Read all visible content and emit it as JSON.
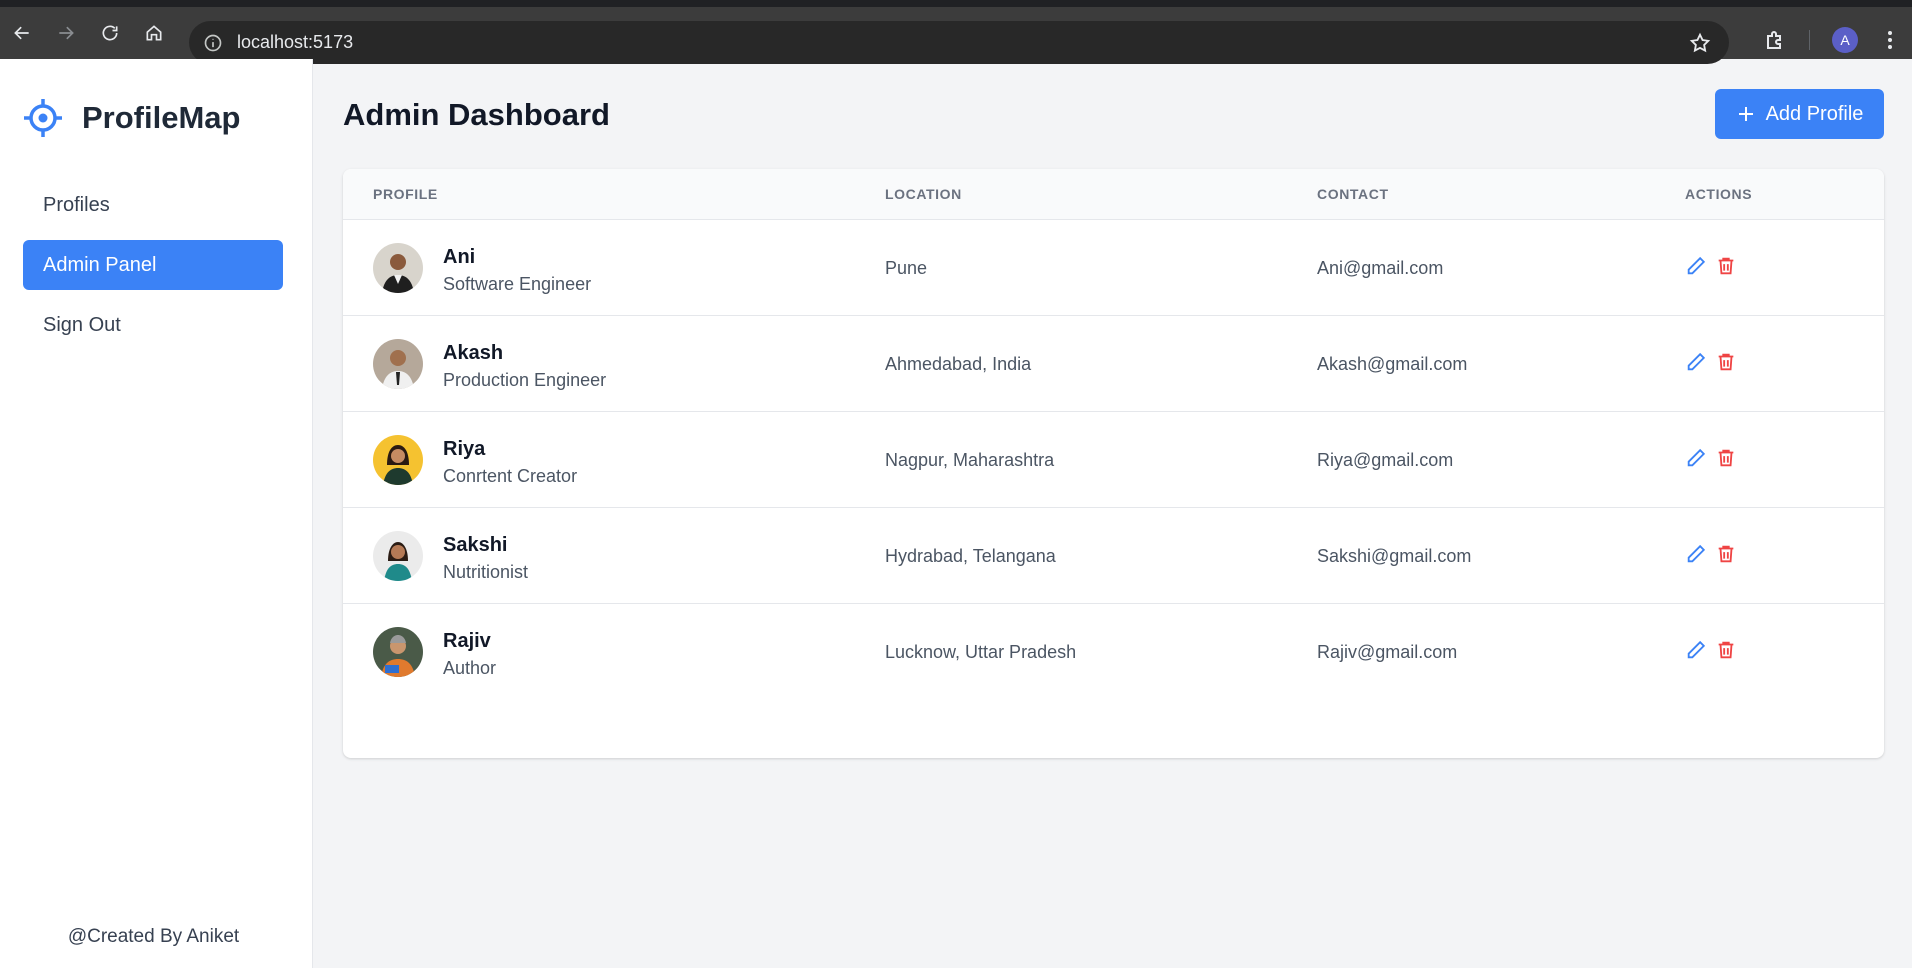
{
  "browser": {
    "url": "localhost:5173",
    "profile_initial": "A"
  },
  "sidebar": {
    "brand": "ProfileMap",
    "items": [
      {
        "label": "Profiles",
        "active": false
      },
      {
        "label": "Admin Panel",
        "active": true
      },
      {
        "label": "Sign Out",
        "active": false
      }
    ],
    "footer": "@Created By Aniket"
  },
  "header": {
    "title": "Admin Dashboard",
    "add_button_label": "Add Profile"
  },
  "table": {
    "columns": [
      "PROFILE",
      "LOCATION",
      "CONTACT",
      "ACTIONS"
    ],
    "rows": [
      {
        "name": "Ani",
        "role": "Software Engineer",
        "location": "Pune",
        "contact": "Ani@gmail.com"
      },
      {
        "name": "Akash",
        "role": "Production Engineer",
        "location": "Ahmedabad, India",
        "contact": "Akash@gmail.com"
      },
      {
        "name": "Riya",
        "role": "Conrtent Creator",
        "location": "Nagpur, Maharashtra",
        "contact": "Riya@gmail.com"
      },
      {
        "name": "Sakshi",
        "role": "Nutritionist",
        "location": "Hydrabad, Telangana",
        "contact": "Sakshi@gmail.com"
      },
      {
        "name": "Rajiv",
        "role": "Author",
        "location": "Lucknow, Uttar Pradesh",
        "contact": "Rajiv@gmail.com"
      }
    ]
  },
  "colors": {
    "accent": "#3b82f6",
    "danger": "#ef4444",
    "page_bg": "#f3f4f6"
  }
}
